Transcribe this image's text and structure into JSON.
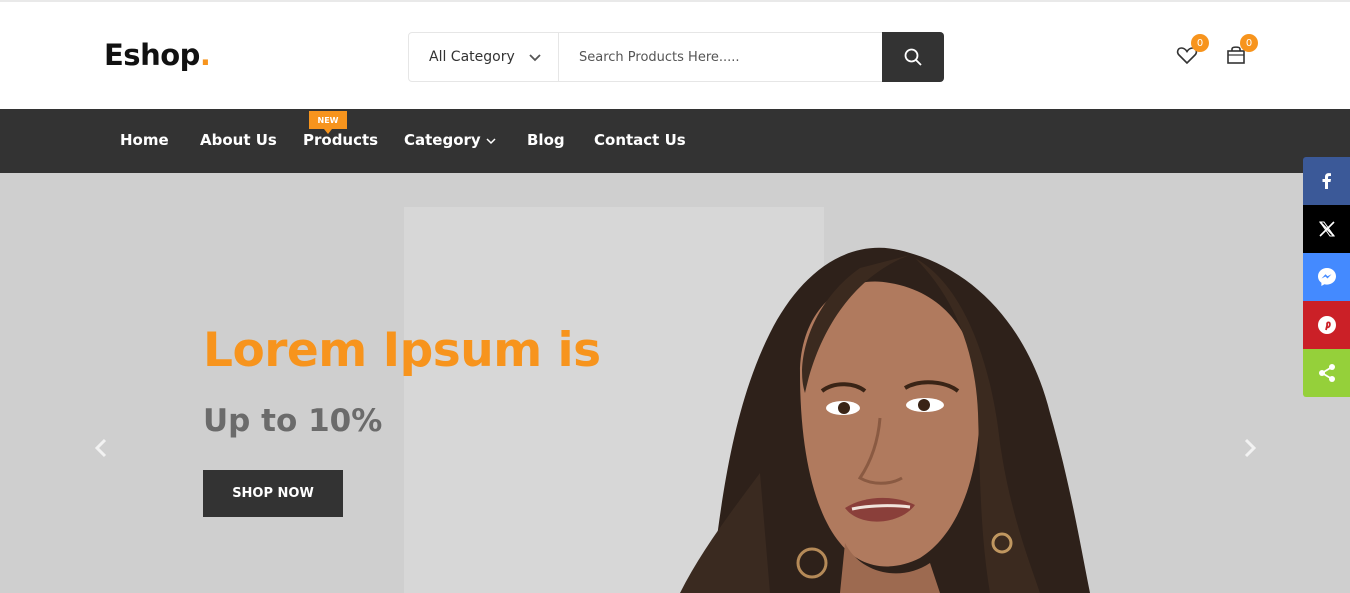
{
  "header": {
    "logo_text": "Eshop",
    "logo_dot": ".",
    "category_select": "All Category",
    "search_placeholder": "Search Products Here.....",
    "wishlist_count": "0",
    "cart_count": "0"
  },
  "nav": {
    "items": [
      {
        "label": "Home"
      },
      {
        "label": "About Us"
      },
      {
        "label": "Products"
      },
      {
        "label": "Category"
      },
      {
        "label": "Blog"
      },
      {
        "label": "Contact Us"
      }
    ],
    "new_badge": "NEW"
  },
  "hero": {
    "title": "Lorem Ipsum is",
    "subtitle": "Up to 10%",
    "button_label": "SHOP NOW"
  },
  "share": {
    "buttons": [
      {
        "icon": "facebook-icon"
      },
      {
        "icon": "x-twitter-icon"
      },
      {
        "icon": "messenger-icon"
      },
      {
        "icon": "pinterest-icon"
      },
      {
        "icon": "share-icon"
      }
    ]
  },
  "colors": {
    "accent": "#f7941d",
    "dark": "#333333",
    "hero_bg": "#cfcfcf"
  }
}
